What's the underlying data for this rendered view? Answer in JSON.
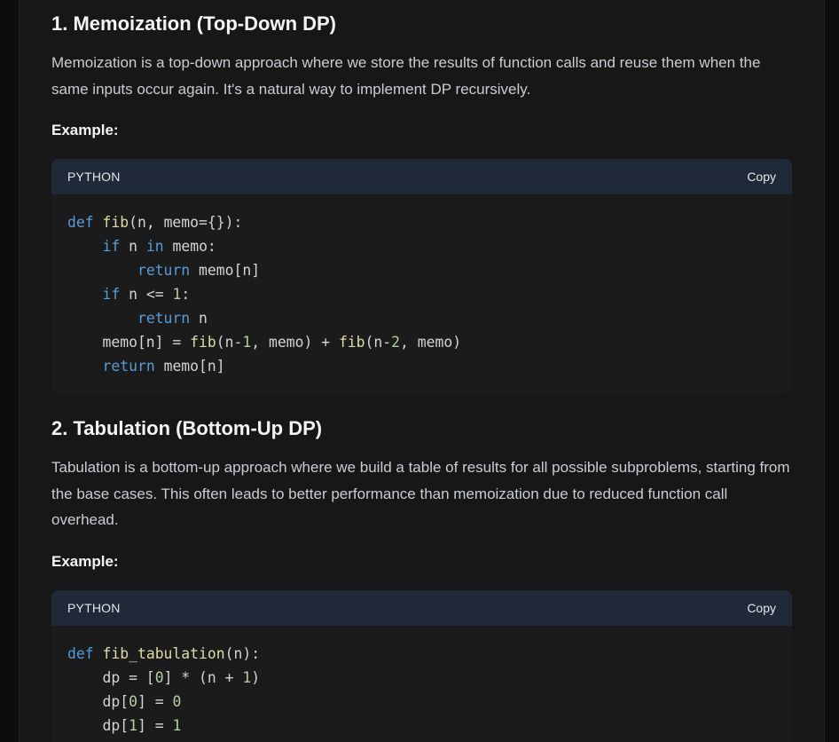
{
  "sections": [
    {
      "title": "1. Memoization (Top-Down DP)",
      "description": "Memoization is a top-down approach where we store the results of function calls and reuse them when the same inputs occur again. It's a natural way to implement DP recursively.",
      "example_label": "Example:",
      "code_block": {
        "language": "PYTHON",
        "copy_label": "Copy",
        "lines": [
          [
            {
              "t": "kw",
              "v": "def "
            },
            {
              "t": "fn",
              "v": "fib"
            },
            {
              "t": "txt",
              "v": "(n, memo={}):"
            }
          ],
          [
            {
              "t": "txt",
              "v": "    "
            },
            {
              "t": "kw",
              "v": "if"
            },
            {
              "t": "txt",
              "v": " n "
            },
            {
              "t": "kw",
              "v": "in"
            },
            {
              "t": "txt",
              "v": " memo:"
            }
          ],
          [
            {
              "t": "txt",
              "v": "        "
            },
            {
              "t": "kw",
              "v": "return"
            },
            {
              "t": "txt",
              "v": " memo[n]"
            }
          ],
          [
            {
              "t": "txt",
              "v": "    "
            },
            {
              "t": "kw",
              "v": "if"
            },
            {
              "t": "txt",
              "v": " n <= "
            },
            {
              "t": "num",
              "v": "1"
            },
            {
              "t": "txt",
              "v": ":"
            }
          ],
          [
            {
              "t": "txt",
              "v": "        "
            },
            {
              "t": "kw",
              "v": "return"
            },
            {
              "t": "txt",
              "v": " n"
            }
          ],
          [
            {
              "t": "txt",
              "v": "    memo[n] = "
            },
            {
              "t": "fn",
              "v": "fib"
            },
            {
              "t": "txt",
              "v": "(n-"
            },
            {
              "t": "num",
              "v": "1"
            },
            {
              "t": "txt",
              "v": ", memo) + "
            },
            {
              "t": "fn",
              "v": "fib"
            },
            {
              "t": "txt",
              "v": "(n-"
            },
            {
              "t": "num",
              "v": "2"
            },
            {
              "t": "txt",
              "v": ", memo)"
            }
          ],
          [
            {
              "t": "txt",
              "v": "    "
            },
            {
              "t": "kw",
              "v": "return"
            },
            {
              "t": "txt",
              "v": " memo[n]"
            }
          ]
        ]
      }
    },
    {
      "title": "2. Tabulation (Bottom-Up DP)",
      "description": "Tabulation is a bottom-up approach where we build a table of results for all possible subproblems, starting from the base cases. This often leads to better performance than memoization due to reduced function call overhead.",
      "example_label": "Example:",
      "code_block": {
        "language": "PYTHON",
        "copy_label": "Copy",
        "lines": [
          [
            {
              "t": "kw",
              "v": "def "
            },
            {
              "t": "fn",
              "v": "fib_tabulation"
            },
            {
              "t": "txt",
              "v": "(n):"
            }
          ],
          [
            {
              "t": "txt",
              "v": "    dp = ["
            },
            {
              "t": "num",
              "v": "0"
            },
            {
              "t": "txt",
              "v": "] * (n + "
            },
            {
              "t": "num",
              "v": "1"
            },
            {
              "t": "txt",
              "v": ")"
            }
          ],
          [
            {
              "t": "txt",
              "v": "    dp["
            },
            {
              "t": "num",
              "v": "0"
            },
            {
              "t": "txt",
              "v": "] = "
            },
            {
              "t": "num",
              "v": "0"
            }
          ],
          [
            {
              "t": "txt",
              "v": "    dp["
            },
            {
              "t": "num",
              "v": "1"
            },
            {
              "t": "txt",
              "v": "] = "
            },
            {
              "t": "num",
              "v": "1"
            }
          ]
        ]
      }
    }
  ],
  "colors": {
    "page_bg": "#0d0d0d",
    "column_bg": "#171717",
    "code_bg": "#1b1b1b",
    "code_header_bg": "#1f2937",
    "keyword": "#569cd6",
    "function": "#dcdcaa",
    "number": "#b5cea8",
    "text": "#d4d4d4"
  }
}
